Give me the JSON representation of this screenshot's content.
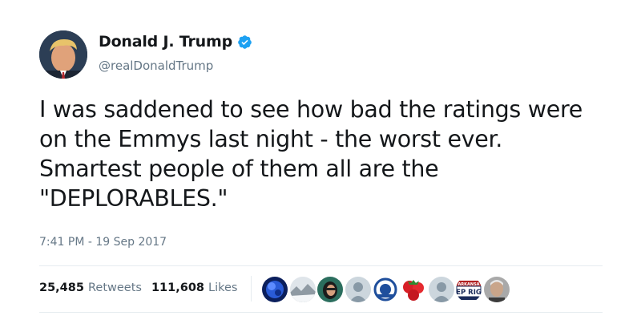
{
  "author": {
    "display_name": "Donald J. Trump",
    "handle": "@realDonaldTrump",
    "verified": true,
    "avatar_icon": "profile-photo",
    "verified_badge_color": "#1da1f2"
  },
  "tweet": {
    "text": "I was saddened to see how bad the ratings were on the Emmys last night - the worst ever. Smartest people of them all are the \"DEPLORABLES.\"",
    "timestamp": "7:41 PM - 19 Sep 2017"
  },
  "stats": {
    "retweets_count": "25,485",
    "retweets_label": "Retweets",
    "likes_count": "111,608",
    "likes_label": "Likes"
  },
  "likers": [
    {
      "icon": "blue-abstract-avatar",
      "color": "#1b3a8c"
    },
    {
      "icon": "winter-landscape-avatar",
      "color": "#cfd6dc"
    },
    {
      "icon": "woman-portrait-avatar",
      "color": "#3a3a3a"
    },
    {
      "icon": "default-egg-avatar",
      "color": "#aab8c2"
    },
    {
      "icon": "logo-badge-avatar",
      "color": "#1f4f9c"
    },
    {
      "icon": "red-strawberries-avatar",
      "color": "#d81f26"
    },
    {
      "icon": "default-egg-avatar",
      "color": "#aab8c2"
    },
    {
      "icon": "campaign-sign-avatar",
      "color": "#b22222",
      "text_top": "ARKANSA",
      "text_main": "EP RIG"
    },
    {
      "icon": "man-portrait-avatar",
      "color": "#6b6b6b"
    }
  ],
  "colors": {
    "text_primary": "#14171a",
    "text_secondary": "#657786",
    "divider": "#e6ecf0"
  }
}
